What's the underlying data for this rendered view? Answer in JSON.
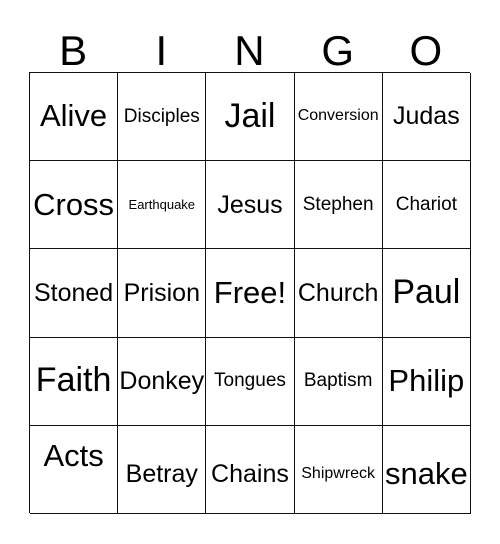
{
  "header": {
    "letters": [
      "B",
      "I",
      "N",
      "G",
      "O"
    ]
  },
  "grid": {
    "columns": 5,
    "rows": 5,
    "cells": [
      [
        {
          "text": "Alive",
          "size": "lg"
        },
        {
          "text": "Disciples",
          "size": "sm"
        },
        {
          "text": "Jail",
          "size": "xl"
        },
        {
          "text": "Conversion",
          "size": "xs"
        },
        {
          "text": "Judas",
          "size": "md"
        }
      ],
      [
        {
          "text": "Cross",
          "size": "lg"
        },
        {
          "text": "Earthquake",
          "size": "xxs"
        },
        {
          "text": "Jesus",
          "size": "md"
        },
        {
          "text": "Stephen",
          "size": "sm"
        },
        {
          "text": "Chariot",
          "size": "sm"
        }
      ],
      [
        {
          "text": "Stoned",
          "size": "md"
        },
        {
          "text": "Prision",
          "size": "md"
        },
        {
          "text": "Free!",
          "size": "lg"
        },
        {
          "text": "Church",
          "size": "md"
        },
        {
          "text": "Paul",
          "size": "xl"
        }
      ],
      [
        {
          "text": "Faith",
          "size": "xl"
        },
        {
          "text": "Donkey",
          "size": "md"
        },
        {
          "text": "Tongues",
          "size": "sm"
        },
        {
          "text": "Baptism",
          "size": "sm"
        },
        {
          "text": "Philip",
          "size": "lg"
        }
      ],
      [
        {
          "text": "Acts",
          "size": "lg"
        },
        {
          "text": "Betray",
          "size": "md"
        },
        {
          "text": "Chains",
          "size": "md"
        },
        {
          "text": "Shipwreck",
          "size": "xs"
        },
        {
          "text": "snake",
          "size": "lg"
        }
      ]
    ],
    "free_space": {
      "row": 2,
      "column": 2,
      "label": "Free!"
    }
  },
  "colors": {
    "background": "#ffffff",
    "cell_background": "#ffffff",
    "border": "#111111",
    "text": "#000000"
  }
}
